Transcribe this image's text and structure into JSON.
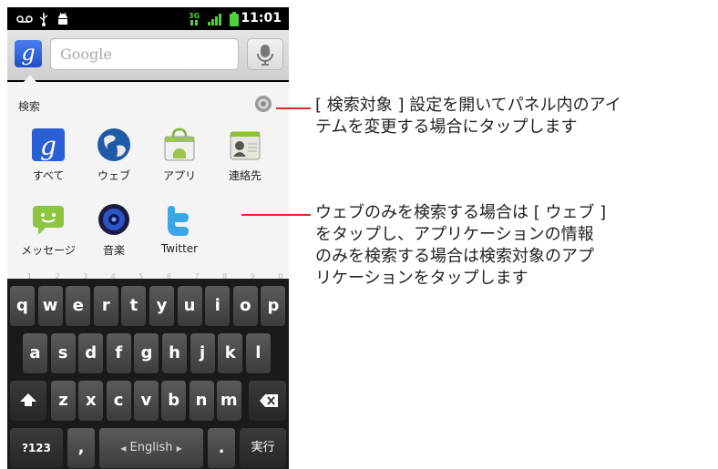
{
  "statusbar": {
    "time": "11:01",
    "network": "3G"
  },
  "search": {
    "placeholder": "Google",
    "google_icon_letter": "g"
  },
  "panel": {
    "title": "検索",
    "items": [
      {
        "label": "すべて",
        "icon": "google-icon"
      },
      {
        "label": "ウェブ",
        "icon": "globe-icon"
      },
      {
        "label": "アプリ",
        "icon": "market-bag-icon"
      },
      {
        "label": "連絡先",
        "icon": "contacts-icon"
      },
      {
        "label": "メッセージ",
        "icon": "messaging-icon"
      },
      {
        "label": "音楽",
        "icon": "music-speaker-icon"
      },
      {
        "label": "Twitter",
        "icon": "twitter-icon"
      }
    ]
  },
  "keyboard": {
    "row1": [
      "q",
      "w",
      "e",
      "r",
      "t",
      "y",
      "u",
      "i",
      "o",
      "p"
    ],
    "row1_hints": [
      "1",
      "2",
      "3",
      "4",
      "5",
      "6",
      "7",
      "8",
      "9",
      "0"
    ],
    "row2": [
      "a",
      "s",
      "d",
      "f",
      "g",
      "h",
      "j",
      "k",
      "l"
    ],
    "row3": [
      "z",
      "x",
      "c",
      "v",
      "b",
      "n",
      "m"
    ],
    "symbols_label": "?123",
    "comma_label": ",",
    "space_label": "English",
    "period_label": ".",
    "enter_label": "実行"
  },
  "callouts": {
    "settings": "[ 検索対象 ] 設定を開いてパネル内のアイ\nテムを変更する場合にタップします",
    "web": "ウェブのみを検索する場合は [ ウェブ ]\nをタップし、アプリケーションの情報\nのみを検索する場合は検索対象のアプ\nリケーションをタップします"
  },
  "colors": {
    "leader": "#e4272d",
    "google_blue": "#2a5fd6",
    "twitter": "#3aa6e8",
    "messaging": "#8cc63f"
  }
}
